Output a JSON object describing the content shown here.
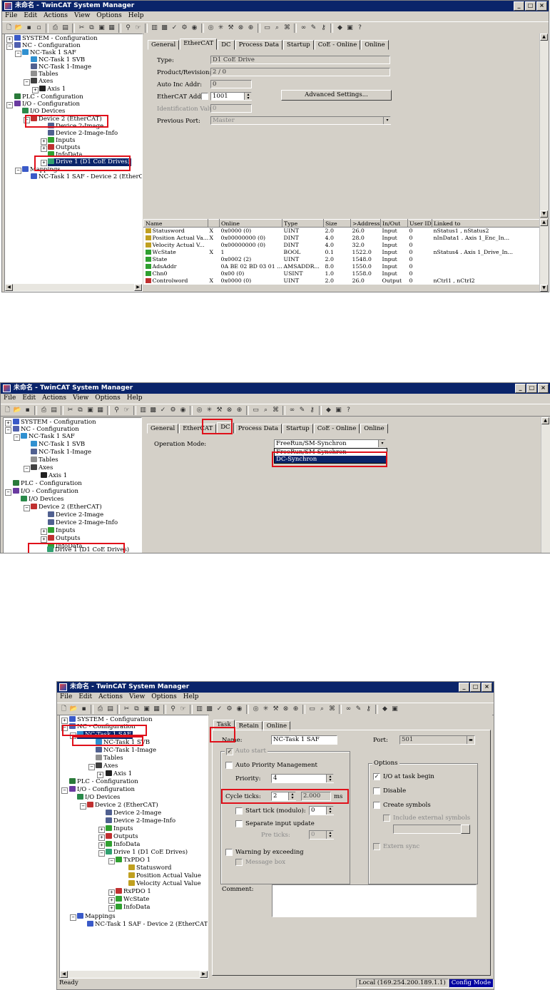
{
  "app": {
    "title": "未命名 - TwinCAT System Manager",
    "menu": [
      "File",
      "Edit",
      "Actions",
      "View",
      "Options",
      "Help"
    ],
    "window_buttons": [
      "_",
      "□",
      "×"
    ]
  },
  "tree_items": {
    "system": "SYSTEM - Configuration",
    "nc": "NC - Configuration",
    "nc_task_saf": "NC-Task 1 SAF",
    "nc_task_svb": "NC-Task 1 SVB",
    "nc_task_image": "NC-Task 1-Image",
    "tables": "Tables",
    "axes": "Axes",
    "axis1": "Axis 1",
    "plc": "PLC - Configuration",
    "io": "I/O - Configuration",
    "io_devices": "I/O Devices",
    "device2": "Device 2 (EtherCAT)",
    "device2_image": "Device 2-Image",
    "device2_image_info": "Device 2-Image-Info",
    "inputs": "Inputs",
    "outputs": "Outputs",
    "infodata": "InfoData",
    "drive1": "Drive 1 (D1 CoE Drives)",
    "txpdo1": "TxPDO 1",
    "statusword": "Statusword",
    "position_actual": "Position Actual Value",
    "velocity_actual": "Velocity Actual Value",
    "rxpdo1": "RxPDO 1",
    "wcstate": "WcState",
    "infodata2": "InfoData",
    "mappings": "Mappings",
    "mapping1": "NC-Task 1 SAF - Device 2 (EtherCAT"
  },
  "shot1": {
    "tabs": [
      "General",
      "EtherCAT",
      "DC",
      "Process Data",
      "Startup",
      "CoE - Online",
      "Online"
    ],
    "selected_tab": "EtherCAT",
    "fields": {
      "type_label": "Type:",
      "type_value": "D1 CoE Drive",
      "product_label": "Product/Revision:",
      "product_value": "2 / 0",
      "autoinc_label": "Auto Inc Addr:",
      "autoinc_value": "0",
      "ethercat_addr_label": "EtherCAT Addr:",
      "ethercat_addr_value": "1001",
      "advanced_button": "Advanced Settings...",
      "ident_label": "Identification Value:",
      "ident_value": "0",
      "prev_port_label": "Previous Port:",
      "prev_port_value": "Master"
    },
    "table": {
      "columns": [
        "Name",
        "",
        "Online",
        "Type",
        "Size",
        ">Address",
        "In/Out",
        "User ID",
        "Linked to"
      ],
      "rows": [
        [
          "Statusword",
          "X",
          "0x0000 (0)",
          "UINT",
          "2.0",
          "26.0",
          "Input",
          "0",
          "nStatus1 , nStatus2"
        ],
        [
          "Position Actual Va...",
          "X",
          "0x00000000 (0)",
          "DINT",
          "4.0",
          "28.0",
          "Input",
          "0",
          "nInData1 . Axis 1_Enc_In..."
        ],
        [
          "Velocity Actual V...",
          "",
          "0x00000000 (0)",
          "DINT",
          "4.0",
          "32.0",
          "Input",
          "0",
          ""
        ],
        [
          "WcState",
          "X",
          "1",
          "BOOL",
          "0.1",
          "1522.0",
          "Input",
          "0",
          "nStatus4 . Axis 1_Drive_In..."
        ],
        [
          "State",
          "",
          "0x0002 (2)",
          "UINT",
          "2.0",
          "1548.0",
          "Input",
          "0",
          ""
        ],
        [
          "AdsAddr",
          "",
          "0A BE 02 BD 03 01 ...",
          "AMSADDR...",
          "8.0",
          "1550.0",
          "Input",
          "0",
          ""
        ],
        [
          "Chn0",
          "",
          "0x00 (0)",
          "USINT",
          "1.0",
          "1558.0",
          "Input",
          "0",
          ""
        ],
        [
          "Controlword",
          "X",
          "0x0000 (0)",
          "UINT",
          "2.0",
          "26.0",
          "Output",
          "0",
          "nCtrl1 , nCtrl2"
        ]
      ]
    }
  },
  "shot2": {
    "tabs": [
      "General",
      "EtherCAT",
      "DC",
      "Process Data",
      "Startup",
      "CoE - Online",
      "Online"
    ],
    "selected_tab": "DC",
    "operation_mode_label": "Operation Mode:",
    "operation_mode_value": "FreeRun/SM-Synchron",
    "dropdown_options": [
      "FreeRun/SM-Synchron",
      "DC-Synchron"
    ]
  },
  "shot3": {
    "tabs": [
      "Task",
      "Retain",
      "Online"
    ],
    "selected_tab": "Task",
    "name_label": "Name:",
    "name_value": "NC-Task 1 SAF",
    "port_label": "Port:",
    "port_value": "501",
    "auto_start": "Auto start",
    "auto_priority": "Auto Priority Management",
    "priority_label": "Priority:",
    "priority_value": "4",
    "cycle_ticks_label": "Cycle ticks:",
    "cycle_ticks_value": "2",
    "cycle_ms_value": "2.000",
    "cycle_unit": "ms",
    "start_tick_label": "Start tick (modulo):",
    "start_tick_value": "0",
    "separate_input": "Separate input update",
    "pre_ticks_label": "Pre ticks:",
    "pre_ticks_value": "0",
    "warning_exceeding": "Warning by exceeding",
    "message_box": "Message box",
    "options_group": "Options",
    "io_at_task_begin": "I/O at task begin",
    "disable": "Disable",
    "create_symbols": "Create symbols",
    "include_external": "Include external symbols",
    "extern_sync": "Extern sync",
    "comment_label": "Comment:",
    "status_ready": "Ready",
    "status_local": "Local (169.254.200.189.1.1)",
    "status_mode": "Config Mode"
  },
  "colors": {
    "titlebar": "#0a246a",
    "highlight_box": "#e0101a",
    "selection": "#0a246a",
    "config_mode": "#0000a0"
  }
}
